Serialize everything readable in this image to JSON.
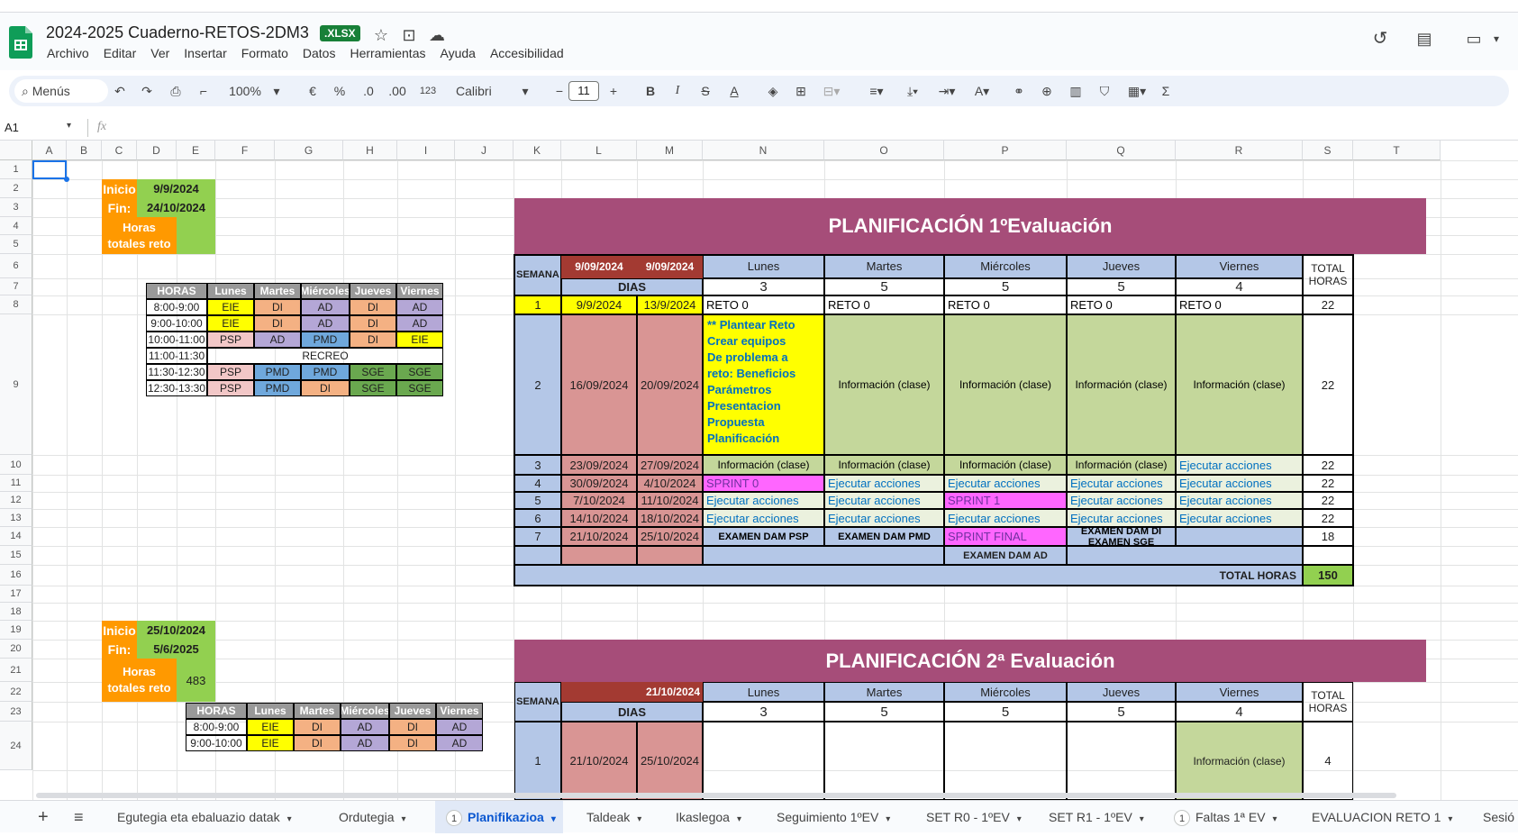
{
  "app": {
    "title": "2024-2025 Cuaderno-RETOS-2DM3",
    "badge": ".XLSX",
    "menu": [
      "Archivo",
      "Editar",
      "Ver",
      "Insertar",
      "Formato",
      "Datos",
      "Herramientas",
      "Ayuda",
      "Accesibilidad"
    ]
  },
  "toolbar": {
    "search": "Menús",
    "zoom": "100%",
    "currency": "€",
    "percent": "%",
    "dec_less": ".0",
    "dec_more": ".00",
    "num_format": "123",
    "font": "Calibri",
    "font_size": "11"
  },
  "formula_bar": {
    "cell_ref": "A1",
    "fx": "fx"
  },
  "columns": [
    "A",
    "B",
    "C",
    "D",
    "E",
    "F",
    "G",
    "H",
    "I",
    "J",
    "K",
    "L",
    "M",
    "N",
    "O",
    "P",
    "Q",
    "R",
    "S",
    "T"
  ],
  "rows": [
    "1",
    "2",
    "3",
    "4",
    "5",
    "6",
    "7",
    "8",
    "9",
    "10",
    "11",
    "12",
    "13",
    "14",
    "15",
    "16",
    "17",
    "18",
    "19",
    "20",
    "21",
    "22",
    "23",
    "24"
  ],
  "block1": {
    "inicio_label": "Inicio",
    "inicio": "9/9/2024",
    "fin_label": "Fin:",
    "fin": "24/10/2024",
    "horas_label_1": "Horas",
    "horas_label_2": "totales reto",
    "horas": ""
  },
  "block2": {
    "inicio_label": "Inicio",
    "inicio": "25/10/2024",
    "fin_label": "Fin:",
    "fin": "5/6/2025",
    "horas_label_1": "Horas",
    "horas_label_2": "totales reto",
    "horas": "483"
  },
  "horario1": {
    "header": [
      "HORAS",
      "Lunes",
      "Martes",
      "Miércoles",
      "Jueves",
      "Viernes"
    ],
    "rows": [
      [
        "8:00-9:00",
        "EIE",
        "DI",
        "AD",
        "DI",
        "AD"
      ],
      [
        "9:00-10:00",
        "EIE",
        "DI",
        "AD",
        "DI",
        "AD"
      ],
      [
        "10:00-11:00",
        "PSP",
        "AD",
        "PMD",
        "DI",
        "EIE"
      ],
      [
        "11:00-11:30",
        "RECREO"
      ],
      [
        "11:30-12:30",
        "PSP",
        "PMD",
        "PMD",
        "SGE",
        "SGE"
      ],
      [
        "12:30-13:30",
        "PSP",
        "PMD",
        "DI",
        "SGE",
        "SGE"
      ]
    ]
  },
  "horario2": {
    "header": [
      "HORAS",
      "Lunes",
      "Martes",
      "Miércoles",
      "Jueves",
      "Viernes"
    ],
    "rows": [
      [
        "8:00-9:00",
        "EIE",
        "DI",
        "AD",
        "DI",
        "AD"
      ],
      [
        "9:00-10:00",
        "EIE",
        "DI",
        "AD",
        "DI",
        "AD"
      ]
    ]
  },
  "plan1": {
    "title": "PLANIFICACIÓN 1ºEvaluación",
    "semana": "SEMANA",
    "date1": "9/09/2024",
    "date2": "9/09/2024",
    "dias": "DIAS",
    "weekdays": [
      "Lunes",
      "Martes",
      "Miércoles",
      "Jueves",
      "Viernes"
    ],
    "daycounts": [
      "3",
      "5",
      "5",
      "5",
      "4"
    ],
    "total_1": "TOTAL",
    "total_2": "HORAS",
    "rows": [
      {
        "w": "1",
        "s": "9/9/2024",
        "e": "13/9/2024",
        "d": [
          "RETO 0",
          "RETO 0",
          "RETO 0",
          "RETO 0",
          "RETO 0"
        ],
        "t": "22"
      },
      {
        "w": "2",
        "s": "16/09/2024",
        "e": "20/09/2024",
        "d": [
          "",
          "Información (clase)",
          "Información (clase)",
          "Información (clase)",
          "Información (clase)"
        ],
        "t": "22"
      },
      {
        "w": "3",
        "s": "23/09/2024",
        "e": "27/09/2024",
        "d": [
          "Información (clase)",
          "Información (clase)",
          "Información (clase)",
          "Información (clase)",
          "Ejecutar  acciones"
        ],
        "t": "22"
      },
      {
        "w": "4",
        "s": "30/09/2024",
        "e": "4/10/2024",
        "d": [
          "SPRINT 0",
          "Ejecutar  acciones",
          "Ejecutar  acciones",
          "Ejecutar  acciones",
          "Ejecutar  acciones"
        ],
        "t": "22"
      },
      {
        "w": "5",
        "s": "7/10/2024",
        "e": "11/10/2024",
        "d": [
          "Ejecutar  acciones",
          "Ejecutar  acciones",
          "SPRINT 1",
          "Ejecutar  acciones",
          "Ejecutar  acciones"
        ],
        "t": "22"
      },
      {
        "w": "6",
        "s": "14/10/2024",
        "e": "18/10/2024",
        "d": [
          "Ejecutar  acciones",
          "Ejecutar  acciones",
          "Ejecutar  acciones",
          "Ejecutar  acciones",
          "Ejecutar  acciones"
        ],
        "t": "22"
      },
      {
        "w": "7",
        "s": "21/10/2024",
        "e": "25/10/2024",
        "d": [
          "EXAMEN  DAM PSP",
          "EXAMEN  DAM PMD",
          "SPRINT FINAL",
          "EXAMEN  DAM DI",
          "",
          ""
        ],
        "t": "18"
      }
    ],
    "monday_w2": [
      "** Plantear Reto",
      "Crear equipos",
      "De problema a",
      "reto: Beneficios",
      "Parámetros",
      "Presentacion",
      "Propuesta",
      "Planificación"
    ],
    "jueves_w7_2": "EXAMEN SGE",
    "row15_exam": "EXAMEN  DAM AD",
    "total_horas_label": "TOTAL HORAS",
    "total_horas": "150"
  },
  "plan2": {
    "title": "PLANIFICACIÓN 2ª Evaluación",
    "semana": "SEMANA",
    "date2": "21/10/2024",
    "dias": "DIAS",
    "weekdays": [
      "Lunes",
      "Martes",
      "Miércoles",
      "Jueves",
      "Viernes"
    ],
    "daycounts": [
      "3",
      "5",
      "5",
      "5",
      "4"
    ],
    "total_1": "TOTAL",
    "total_2": "HORAS",
    "row1": {
      "w": "1",
      "s": "21/10/2024",
      "e": "25/10/2024",
      "viernes": "Información (clase)",
      "t": "4"
    }
  },
  "sheet_tabs": [
    {
      "label": "Egutegia eta ebaluazio datak"
    },
    {
      "label": "Ordutegia"
    },
    {
      "label": "Planifikazioa",
      "badge": "1",
      "active": true
    },
    {
      "label": "Taldeak"
    },
    {
      "label": "Ikaslegoa"
    },
    {
      "label": "Seguimiento 1ºEV"
    },
    {
      "label": "SET R0 - 1ºEV"
    },
    {
      "label": "SET R1 - 1ºEV"
    },
    {
      "label": "Faltas 1ª EV",
      "badge": "1"
    },
    {
      "label": "EVALUACION RETO 1"
    },
    {
      "label": "Sesió"
    }
  ],
  "colors": {
    "plan_title": "#a64d79",
    "date_dark": "#a33a32",
    "date_light": "#d99594",
    "weekday": "#b4c7e7",
    "green_cell": "#c4d79b",
    "light_green": "#ebf1de",
    "orange": "#ff9900",
    "green": "#92d050",
    "yellow": "#ffff00",
    "magenta": "#ff66ff"
  }
}
